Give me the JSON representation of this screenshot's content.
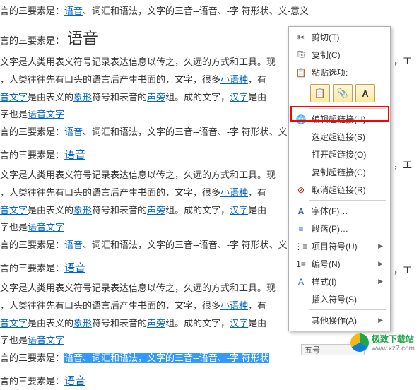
{
  "text": {
    "line1_prefix": "言的三要素是：",
    "yuyin": "语音",
    "vocab_grammar": "、词汇和语法，文字的三音--语音、-字 符形状、义-意义",
    "title_prefix": "言的三要素是：",
    "title_big": "语音",
    "para2a": "文字是人类用表义符号记录表达信息以传之，久远的方式和工具。现",
    "para2b_a": "，人类往往先有口头的语言后产生书面的，文字，很多",
    "xiaoyuzhong": "小语种",
    "para2b_b": "，有",
    "para2c_a": "音文字",
    "para2c_b": "是由表义的",
    "xiangxing": "象形",
    "para2c_c": "符号和表音的",
    "shengpang": "声旁",
    "para2c_d": "组。成的文字，",
    "hanzi": "汉字",
    "para2c_e": "是由",
    "para2d_a": "字也是",
    "yuyinwenzi": "语音文字",
    "title2_prefix": "言的三要素是：",
    "gong": "，工",
    "sel_prefix": "言的三要素是：",
    "sel_text": "语音、词汇和语法，文字的三音--语音、-字 符形状"
  },
  "menu": {
    "cut": "剪切(T)",
    "copy": "复制(C)",
    "paste_title": "粘贴选项:",
    "edit_link": "编辑超链接(H)…",
    "select_link": "选定超链接(S)",
    "open_link": "打开超链接(O)",
    "copy_link": "复制超链接(C)",
    "remove_link": "取消超链接(R)",
    "font": "字体(F)…",
    "paragraph": "段落(P)…",
    "bullet": "项目符号(U)",
    "numbering": "编号(N)",
    "style": "样式(I)",
    "insert_symbol": "插入符号(S)",
    "other": "其他操作(A)"
  },
  "bottombar": "五号",
  "watermark": {
    "site": "极致下载站",
    "url": "www.xz7.com"
  }
}
